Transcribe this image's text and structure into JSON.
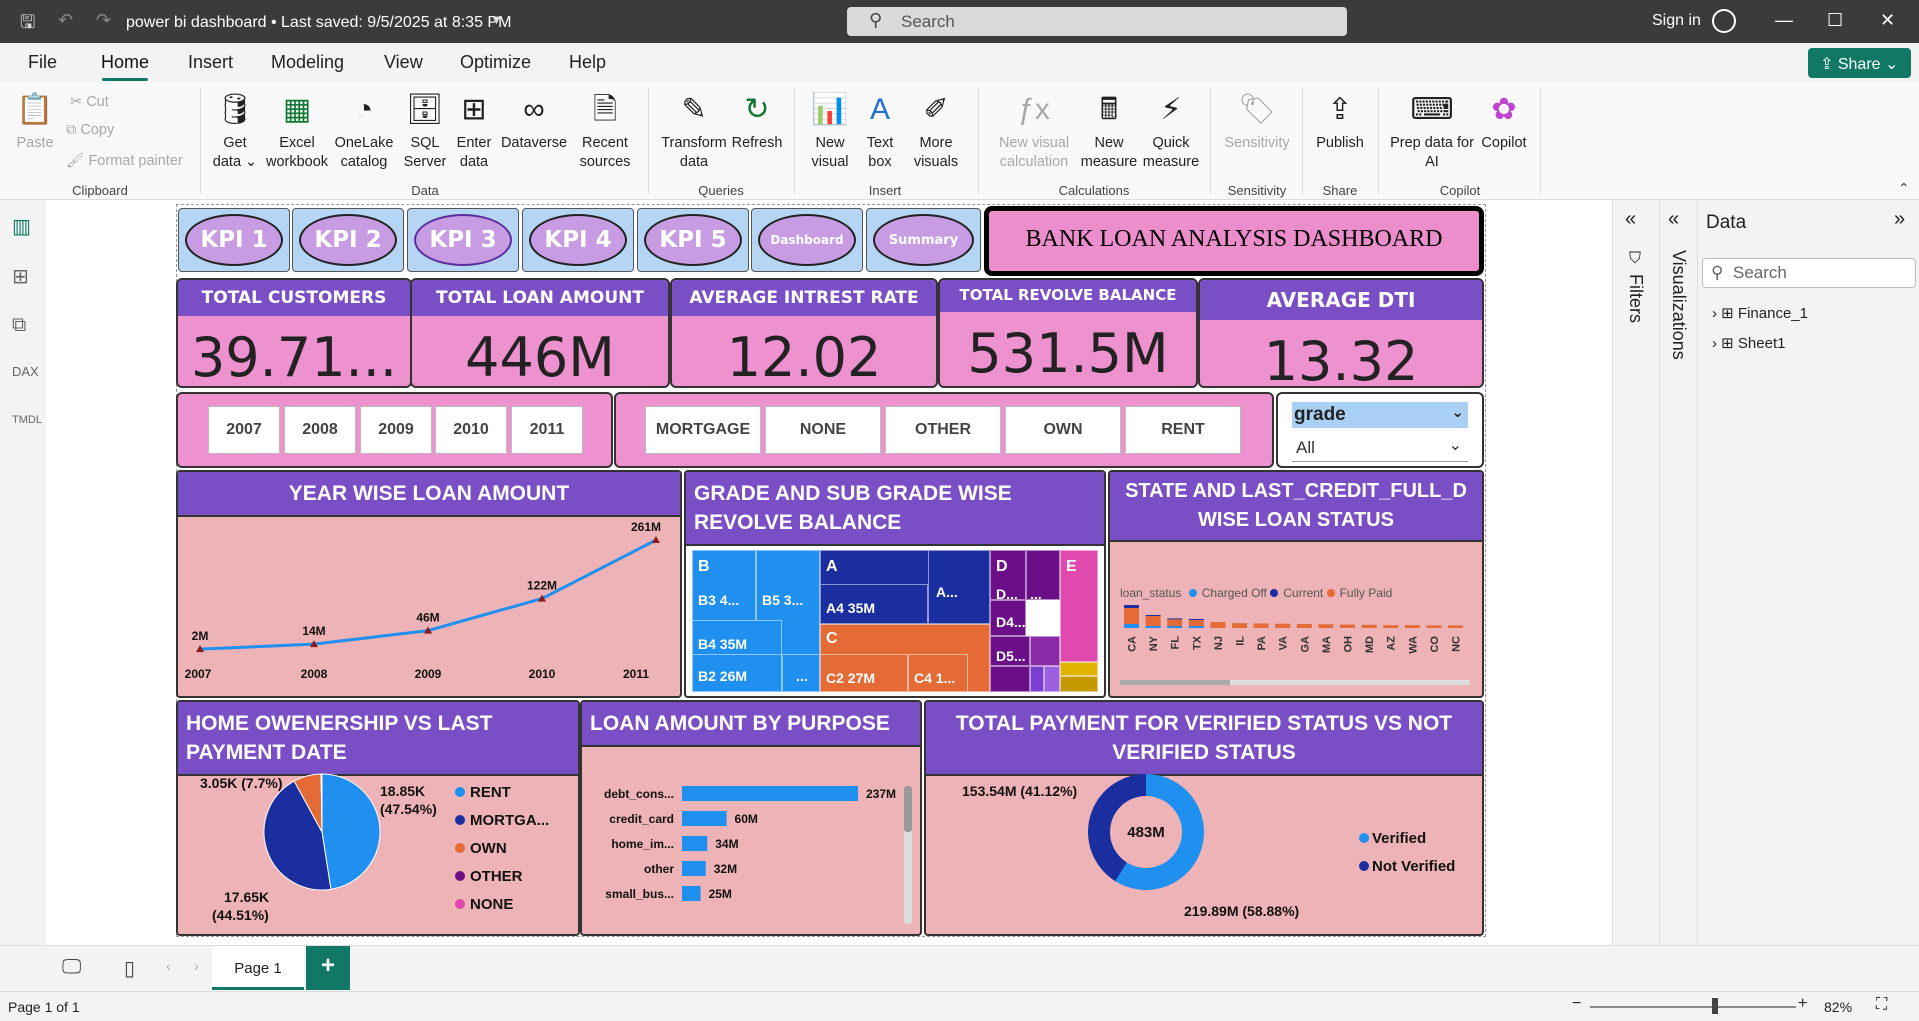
{
  "titlebar": {
    "doc_title": "power bi dashboard • Last saved: 9/5/2025 at 8:35 PM",
    "search_placeholder": "Search",
    "sign_in": "Sign in"
  },
  "menu": {
    "file": "File",
    "home": "Home",
    "insert": "Insert",
    "modeling": "Modeling",
    "view": "View",
    "optimize": "Optimize",
    "help": "Help",
    "share": "Share"
  },
  "ribbon": {
    "paste": "Paste",
    "cut": "Cut",
    "copy": "Copy",
    "format_painter": "Format painter",
    "get_data": "Get data",
    "excel": "Excel workbook",
    "onelake": "OneLake catalog",
    "sql": "SQL Server",
    "enter_data": "Enter data",
    "dataverse": "Dataverse",
    "recent": "Recent sources",
    "transform": "Transform data",
    "refresh": "Refresh",
    "new_visual": "New visual",
    "text_box": "Text box",
    "more_visuals": "More visuals",
    "new_calc": "New visual calculation",
    "new_measure": "New measure",
    "quick_measure": "Quick measure",
    "sensitivity": "Sensitivity",
    "publish": "Publish",
    "prep_ai": "Prep data for AI",
    "copilot": "Copilot",
    "groups": {
      "clipboard": "Clipboard",
      "data": "Data",
      "queries": "Queries",
      "insert": "Insert",
      "calculations": "Calculations",
      "sensitivity": "Sensitivity",
      "share": "Share",
      "copilot": "Copilot"
    }
  },
  "nav_buttons": [
    "KPI 1",
    "KPI 2",
    "KPI 3",
    "KPI 4",
    "KPI 5",
    "Dashboard",
    "Summary"
  ],
  "dashboard_title": "BANK LOAN ANALYSIS DASHBOARD",
  "kpis": [
    {
      "label": "TOTAL CUSTOMERS",
      "value": "39.71..."
    },
    {
      "label": "TOTAL LOAN AMOUNT",
      "value": "446M"
    },
    {
      "label": "AVERAGE INTREST RATE",
      "value": "12.02"
    },
    {
      "label": "TOTAL REVOLVE BALANCE",
      "value": "531.5M"
    },
    {
      "label": "AVERAGE DTI",
      "value": "13.32"
    }
  ],
  "year_slicer": [
    "2007",
    "2008",
    "2009",
    "2010",
    "2011"
  ],
  "home_slicer": [
    "MORTGAGE",
    "NONE",
    "OTHER",
    "OWN",
    "RENT"
  ],
  "grade_slicer": {
    "label": "grade",
    "value": "All"
  },
  "visuals": {
    "year_title": "YEAR WISE LOAN AMOUNT",
    "grade_title": "GRADE AND SUB GRADE WISE REVOLVE BALANCE",
    "state_title": "STATE AND LAST_CREDIT_FULL_D WISE LOAN STATUS",
    "home_title": "HOME OWENERSHIP VS LAST PAYMENT DATE",
    "purpose_title": "LOAN AMOUNT BY PURPOSE",
    "verified_title": "TOTAL PAYMENT FOR VERIFIED STATUS VS NOT VERIFIED STATUS"
  },
  "chart_data": [
    {
      "type": "line",
      "x": [
        "2007",
        "2008",
        "2009",
        "2010",
        "2011"
      ],
      "values": [
        2,
        14,
        46,
        122,
        261
      ],
      "labels": [
        "2M",
        "14M",
        "46M",
        "122M",
        "261M"
      ],
      "color": "#1f8ff0"
    },
    {
      "type": "treemap",
      "cells": [
        {
          "label": "B",
          "color": "#1f8ff0"
        },
        {
          "label": "B3 4...",
          "color": "#1f8ff0"
        },
        {
          "label": "B5 3...",
          "color": "#1f8ff0"
        },
        {
          "label": "B4 35M",
          "color": "#1f8ff0"
        },
        {
          "label": "B2 26M",
          "color": "#1f8ff0"
        },
        {
          "label": "...",
          "color": "#1f8ff0"
        },
        {
          "label": "A",
          "color": "#1a2ea0"
        },
        {
          "label": "A4 35M",
          "color": "#1a2ea0"
        },
        {
          "label": "A...",
          "color": "#1a2ea0"
        },
        {
          "label": "C",
          "color": "#e56b36"
        },
        {
          "label": "C2 27M",
          "color": "#e56b36"
        },
        {
          "label": "C4 1...",
          "color": "#e56b36"
        },
        {
          "label": "D",
          "color": "#6a0f87"
        },
        {
          "label": "D...",
          "color": "#6a0f87"
        },
        {
          "label": "...",
          "color": "#6a0f87"
        },
        {
          "label": "D4...",
          "color": "#6a0f87"
        },
        {
          "label": "D5...",
          "color": "#6a0f87"
        },
        {
          "label": "E",
          "color": "#e04aae"
        }
      ]
    },
    {
      "type": "bar",
      "legend_title": "loan_status",
      "series": [
        {
          "name": "Charged Off",
          "color": "#1f8ff0"
        },
        {
          "name": "Current",
          "color": "#1a2ea0"
        },
        {
          "name": "Fully Paid",
          "color": "#e56b36"
        }
      ],
      "categories": [
        "CA",
        "NY",
        "FL",
        "TX",
        "NJ",
        "IL",
        "PA",
        "VA",
        "GA",
        "MA",
        "OH",
        "MD",
        "AZ",
        "WA",
        "CO",
        "NC"
      ],
      "values": [
        7,
        4.2,
        3,
        2.8,
        2.1,
        1.7,
        1.6,
        1.5,
        1.4,
        1.3,
        1.2,
        1.1,
        1.0,
        1.0,
        0.9,
        0.9
      ]
    },
    {
      "type": "pie",
      "slices": [
        {
          "name": "RENT",
          "value": 47.54,
          "label": "18.85K (47.54%)",
          "color": "#1f8ff0"
        },
        {
          "name": "MORTGA...",
          "value": 44.51,
          "label": "17.65K (44.51%)",
          "color": "#1a2ea0"
        },
        {
          "name": "OWN",
          "value": 7.7,
          "label": "3.05K (7.7%)",
          "color": "#e56b36"
        },
        {
          "name": "OTHER",
          "value": 0.2,
          "color": "#6a0f87"
        },
        {
          "name": "NONE",
          "value": 0.05,
          "color": "#e04aae"
        }
      ]
    },
    {
      "type": "bar",
      "categories": [
        "debt_cons...",
        "credit_card",
        "home_im...",
        "other",
        "small_bus..."
      ],
      "values": [
        237,
        60,
        34,
        32,
        25
      ],
      "labels": [
        "237M",
        "60M",
        "34M",
        "32M",
        "25M"
      ],
      "color": "#1f8ff0"
    },
    {
      "type": "pie",
      "donut": true,
      "center_label": "483M",
      "slices": [
        {
          "name": "Verified",
          "value": 58.88,
          "label": "219.89M (58.88%)",
          "color": "#1f8ff0"
        },
        {
          "name": "Not Verified",
          "value": 41.12,
          "label": "153.54M (41.12%)",
          "color": "#1a2ea0"
        }
      ]
    }
  ],
  "panes": {
    "filters": "Filters",
    "visualizations": "Visualizations",
    "data": "Data",
    "search": "Search",
    "tables": [
      "Finance_1",
      "Sheet1"
    ]
  },
  "pages": {
    "page1": "Page 1"
  },
  "status": {
    "page": "Page 1 of 1",
    "zoom": "82%"
  }
}
